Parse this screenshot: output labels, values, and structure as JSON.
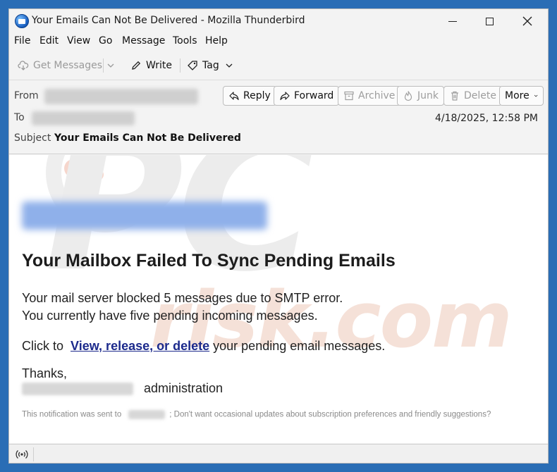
{
  "window": {
    "title": "Your Emails Can Not Be Delivered - Mozilla Thunderbird"
  },
  "menu": {
    "items": [
      "File",
      "Edit",
      "View",
      "Go",
      "Message",
      "Tools",
      "Help"
    ]
  },
  "toolbar": {
    "get_messages": "Get Messages",
    "write": "Write",
    "tag": "Tag"
  },
  "header": {
    "from_label": "From",
    "to_label": "To",
    "subject_label": "Subject",
    "subject": "Your Emails Can Not Be Delivered",
    "date": "4/18/2025, 12:58 PM",
    "buttons": {
      "reply": "Reply",
      "forward": "Forward",
      "archive": "Archive",
      "junk": "Junk",
      "delete": "Delete",
      "more": "More"
    }
  },
  "body": {
    "heading": "Your Mailbox Failed To Sync Pending Emails",
    "line1": "Your mail server blocked 5 messages due to SMTP error.",
    "line2": "You currently have five pending incoming messages.",
    "click_prefix": "Click to",
    "link_text": "View, release, or delete",
    "click_suffix": " your pending email messages.",
    "thanks": "Thanks,",
    "admin": "administration",
    "footer_prefix": "This notification was sent to",
    "footer_suffix": "; Don't want occasional updates about subscription preferences and friendly suggestions?"
  },
  "watermark": {
    "text_top": "PC",
    "text_bottom": "risk.com"
  },
  "colors": {
    "accent": "#2a6db5",
    "link": "#1c2a8c"
  }
}
